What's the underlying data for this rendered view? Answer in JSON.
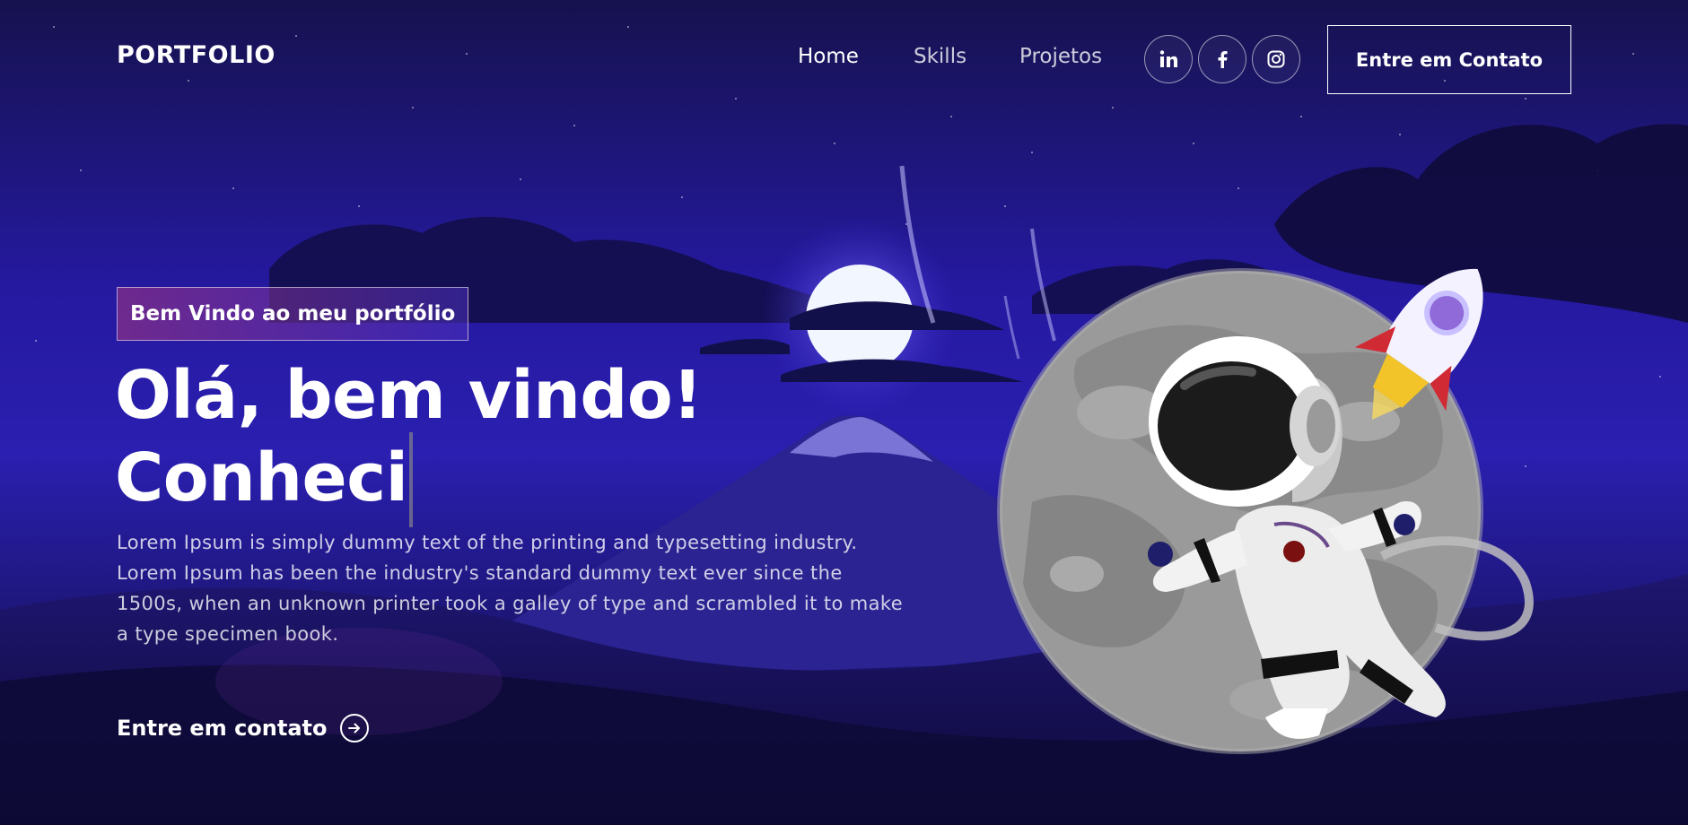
{
  "nav": {
    "logo": "PORTFOLIO",
    "links": [
      {
        "label": "Home"
      },
      {
        "label": "Skills"
      },
      {
        "label": "Projetos"
      }
    ],
    "social": [
      {
        "icon": "linkedin-icon"
      },
      {
        "icon": "facebook-icon"
      },
      {
        "icon": "instagram-icon"
      }
    ],
    "contact_button": "Entre em Contato"
  },
  "hero": {
    "tagline": "Bem Vindo ao meu portfólio",
    "headline_line1": "Olá, bem vindo!",
    "headline_line2": "Conheci",
    "description": "Lorem Ipsum is simply dummy text of the printing and typesetting industry. Lorem Ipsum has been the industry's standard dummy text ever since the 1500s, when an unknown printer took a galley of type and scrambled it to make a type specimen book.",
    "cta": "Entre em contato",
    "cta_icon": "arrow-right-circle-icon"
  },
  "colors": {
    "sky_top": "#1a1560",
    "sky_mid": "#2a1fa8",
    "accent_purple": "#aa367c",
    "accent_blue": "#4a2fbd"
  }
}
